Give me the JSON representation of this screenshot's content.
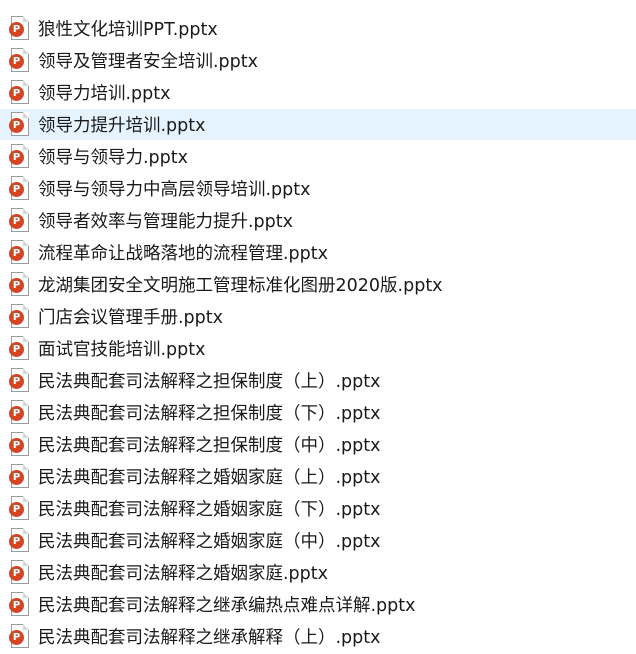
{
  "accent": {
    "selected_row_bg": "#e5f3ff",
    "pptx_icon_color": "#d24726"
  },
  "icon": {
    "name": "powerpoint-file-icon",
    "glyph": "P"
  },
  "selected_index": 3,
  "files": [
    {
      "name": "狼性文化培训PPT.pptx"
    },
    {
      "name": "领导及管理者安全培训.pptx"
    },
    {
      "name": "领导力培训.pptx"
    },
    {
      "name": "领导力提升培训.pptx"
    },
    {
      "name": "领导与领导力.pptx"
    },
    {
      "name": "领导与领导力中高层领导培训.pptx"
    },
    {
      "name": "领导者效率与管理能力提升.pptx"
    },
    {
      "name": "流程革命让战略落地的流程管理.pptx"
    },
    {
      "name": "龙湖集团安全文明施工管理标准化图册2020版.pptx"
    },
    {
      "name": "门店会议管理手册.pptx"
    },
    {
      "name": "面试官技能培训.pptx"
    },
    {
      "name": "民法典配套司法解释之担保制度（上）.pptx"
    },
    {
      "name": "民法典配套司法解释之担保制度（下）.pptx"
    },
    {
      "name": "民法典配套司法解释之担保制度（中）.pptx"
    },
    {
      "name": "民法典配套司法解释之婚姻家庭（上）.pptx"
    },
    {
      "name": "民法典配套司法解释之婚姻家庭（下）.pptx"
    },
    {
      "name": "民法典配套司法解释之婚姻家庭（中）.pptx"
    },
    {
      "name": "民法典配套司法解释之婚姻家庭.pptx"
    },
    {
      "name": "民法典配套司法解释之继承编热点难点详解.pptx"
    },
    {
      "name": "民法典配套司法解释之继承解释（上）.pptx"
    }
  ]
}
